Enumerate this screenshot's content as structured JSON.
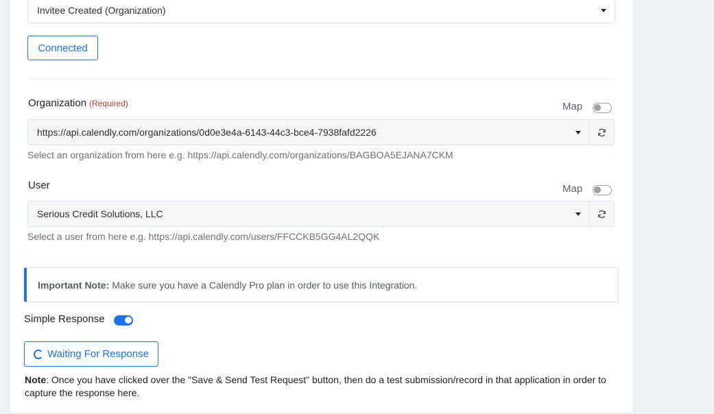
{
  "trigger": {
    "selected": "Invitee Created (Organization)"
  },
  "connected_button": "Connected",
  "organization": {
    "label": "Organization",
    "required": "(Required)",
    "map_label": "Map",
    "value": "https://api.calendly.com/organizations/0d0e3e4a-6143-44c3-bce4-7938fafd2226",
    "help": "Select an organization from here e.g. https://api.calendly.com/organizations/BAGBOA5EJANA7CKM"
  },
  "user": {
    "label": "User",
    "map_label": "Map",
    "value": "Serious Credit Solutions, LLC",
    "help": "Select a user from here e.g. https://api.calendly.com/users/FFCCKB5GG4AL2QQK"
  },
  "important_note": {
    "title": "Important Note:",
    "text": "Make sure you have a Calendly Pro plan in order to use this Integration."
  },
  "simple_response": {
    "label": "Simple Response",
    "enabled": true
  },
  "waiting_button": "Waiting For Response",
  "footnote": {
    "title": "Note",
    "text": ": Once you have clicked over the \"Save & Send Test Request\" button, then do a test submission/record in that application in order to capture the response here."
  },
  "colors": {
    "accent": "#1a73e8",
    "required": "#c0392b"
  }
}
